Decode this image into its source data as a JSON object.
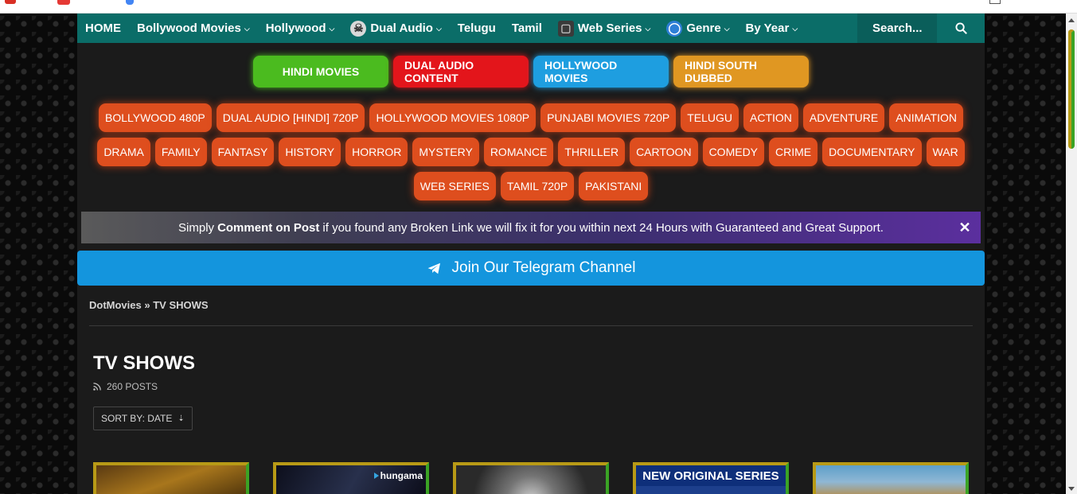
{
  "nav": {
    "items": [
      {
        "label": "HOME",
        "has_dropdown": false,
        "icon": ""
      },
      {
        "label": "Bollywood Movies",
        "has_dropdown": true,
        "icon": ""
      },
      {
        "label": "Hollywood",
        "has_dropdown": true,
        "icon": ""
      },
      {
        "label": "Dual Audio",
        "has_dropdown": true,
        "icon": "skull-icon"
      },
      {
        "label": "Telugu",
        "has_dropdown": false,
        "icon": ""
      },
      {
        "label": "Tamil",
        "has_dropdown": false,
        "icon": ""
      },
      {
        "label": "Web Series",
        "has_dropdown": true,
        "icon": "tv-icon"
      },
      {
        "label": "Genre",
        "has_dropdown": true,
        "icon": "globe-icon"
      },
      {
        "label": "By Year",
        "has_dropdown": true,
        "icon": ""
      }
    ],
    "search_placeholder": "Search...",
    "bar_color": "#0b6d68"
  },
  "top_categories": [
    {
      "label": "HINDI MOVIES",
      "color": "#4bbb1f"
    },
    {
      "label": "DUAL AUDIO CONTENT",
      "color": "#e3151b"
    },
    {
      "label": "HOLLYWOOD MOVIES",
      "color": "#1e9ee0"
    },
    {
      "label": "HINDI SOUTH DUBBED",
      "color": "#e09722"
    }
  ],
  "tags": [
    "BOLLYWOOD 480P",
    "DUAL AUDIO [HINDI] 720P",
    "HOLLYWOOD MOVIES 1080P",
    "PUNJABI MOVIES 720P",
    "TELUGU",
    "ACTION",
    "ADVENTURE",
    "ANIMATION",
    "DRAMA",
    "FAMILY",
    "FANTASY",
    "HISTORY",
    "HORROR",
    "MYSTERY",
    "ROMANCE",
    "THRILLER",
    "CARTOON",
    "COMEDY",
    "CRIME",
    "DOCUMENTARY",
    "WAR",
    "WEB SERIES",
    "TAMIL 720P",
    "PAKISTANI"
  ],
  "notice": {
    "prefix": "Simply",
    "bold": "Comment on Post",
    "suffix": "if you found any Broken Link we will fix it for you within next 24 Hours with Guaranteed and Great Support.",
    "close": "✕"
  },
  "telegram": {
    "label": "Join Our Telegram Channel",
    "color": "#1495dd"
  },
  "breadcrumb": {
    "home": "DotMovies",
    "sep": "»",
    "current": "TV SHOWS"
  },
  "section": {
    "title": "TV SHOWS",
    "posts_count": "260 POSTS",
    "sort_label": "SORT BY:",
    "sort_value": "DATE"
  },
  "thumbnails": [
    {
      "brand": "",
      "banner": ""
    },
    {
      "brand": "hungama",
      "banner": ""
    },
    {
      "brand": "",
      "banner": ""
    },
    {
      "brand": "",
      "banner": "NEW ORIGINAL SERIES"
    },
    {
      "brand": "",
      "banner": ""
    }
  ]
}
